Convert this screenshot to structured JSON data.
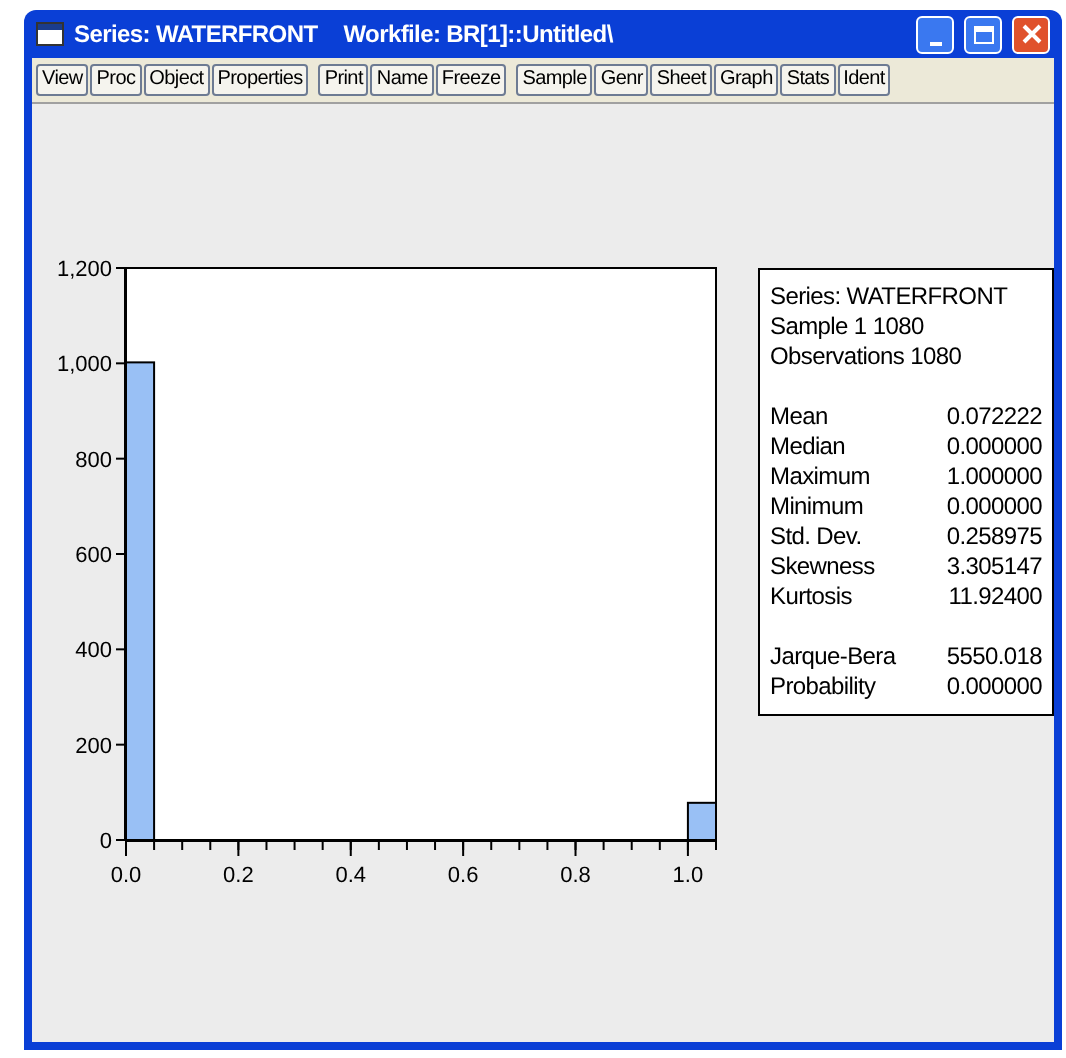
{
  "window": {
    "title": "Series: WATERFRONT",
    "subtitle": "Workfile: BR[1]::Untitled\\"
  },
  "toolbar": [
    [
      "View",
      "Proc",
      "Object",
      "Properties"
    ],
    [
      "Print",
      "Name",
      "Freeze"
    ],
    [
      "Sample",
      "Genr",
      "Sheet",
      "Graph",
      "Stats",
      "Ident"
    ]
  ],
  "histogram": {
    "chart_data": {
      "type": "bar",
      "x": [
        0,
        1
      ],
      "values": [
        1002,
        78
      ],
      "xlim": [
        0,
        1.05
      ],
      "ylim": [
        0,
        1200
      ],
      "xticks": [
        {
          "value": 0,
          "label": "0.0"
        },
        {
          "value": 0.2,
          "label": "0.2"
        },
        {
          "value": 0.4,
          "label": "0.4"
        },
        {
          "value": 0.6,
          "label": "0.6"
        },
        {
          "value": 0.8,
          "label": "0.8"
        },
        {
          "value": 1,
          "label": "1.0"
        }
      ],
      "yticks": [
        {
          "value": 0,
          "label": "0"
        },
        {
          "value": 200,
          "label": "200"
        },
        {
          "value": 400,
          "label": "400"
        },
        {
          "value": 600,
          "label": "600"
        },
        {
          "value": 800,
          "label": "800"
        },
        {
          "value": 1000,
          "label": "1,000"
        },
        {
          "value": 1200,
          "label": "1,200"
        }
      ]
    }
  },
  "stats_box": {
    "header": [
      "Series: WATERFRONT",
      "Sample 1 1080",
      "Observations 1080"
    ],
    "rows": [
      {
        "label": "Mean",
        "value": "0.072222"
      },
      {
        "label": "Median",
        "value": "0.000000"
      },
      {
        "label": "Maximum",
        "value": "1.000000"
      },
      {
        "label": "Minimum",
        "value": "0.000000"
      },
      {
        "label": "Std. Dev.",
        "value": "0.258975"
      },
      {
        "label": "Skewness",
        "value": "3.305147"
      },
      {
        "label": "Kurtosis",
        "value": "11.92400"
      }
    ],
    "tests": [
      {
        "label": "Jarque-Bera",
        "value": "5550.018"
      },
      {
        "label": "Probability",
        "value": "0.000000"
      }
    ]
  }
}
